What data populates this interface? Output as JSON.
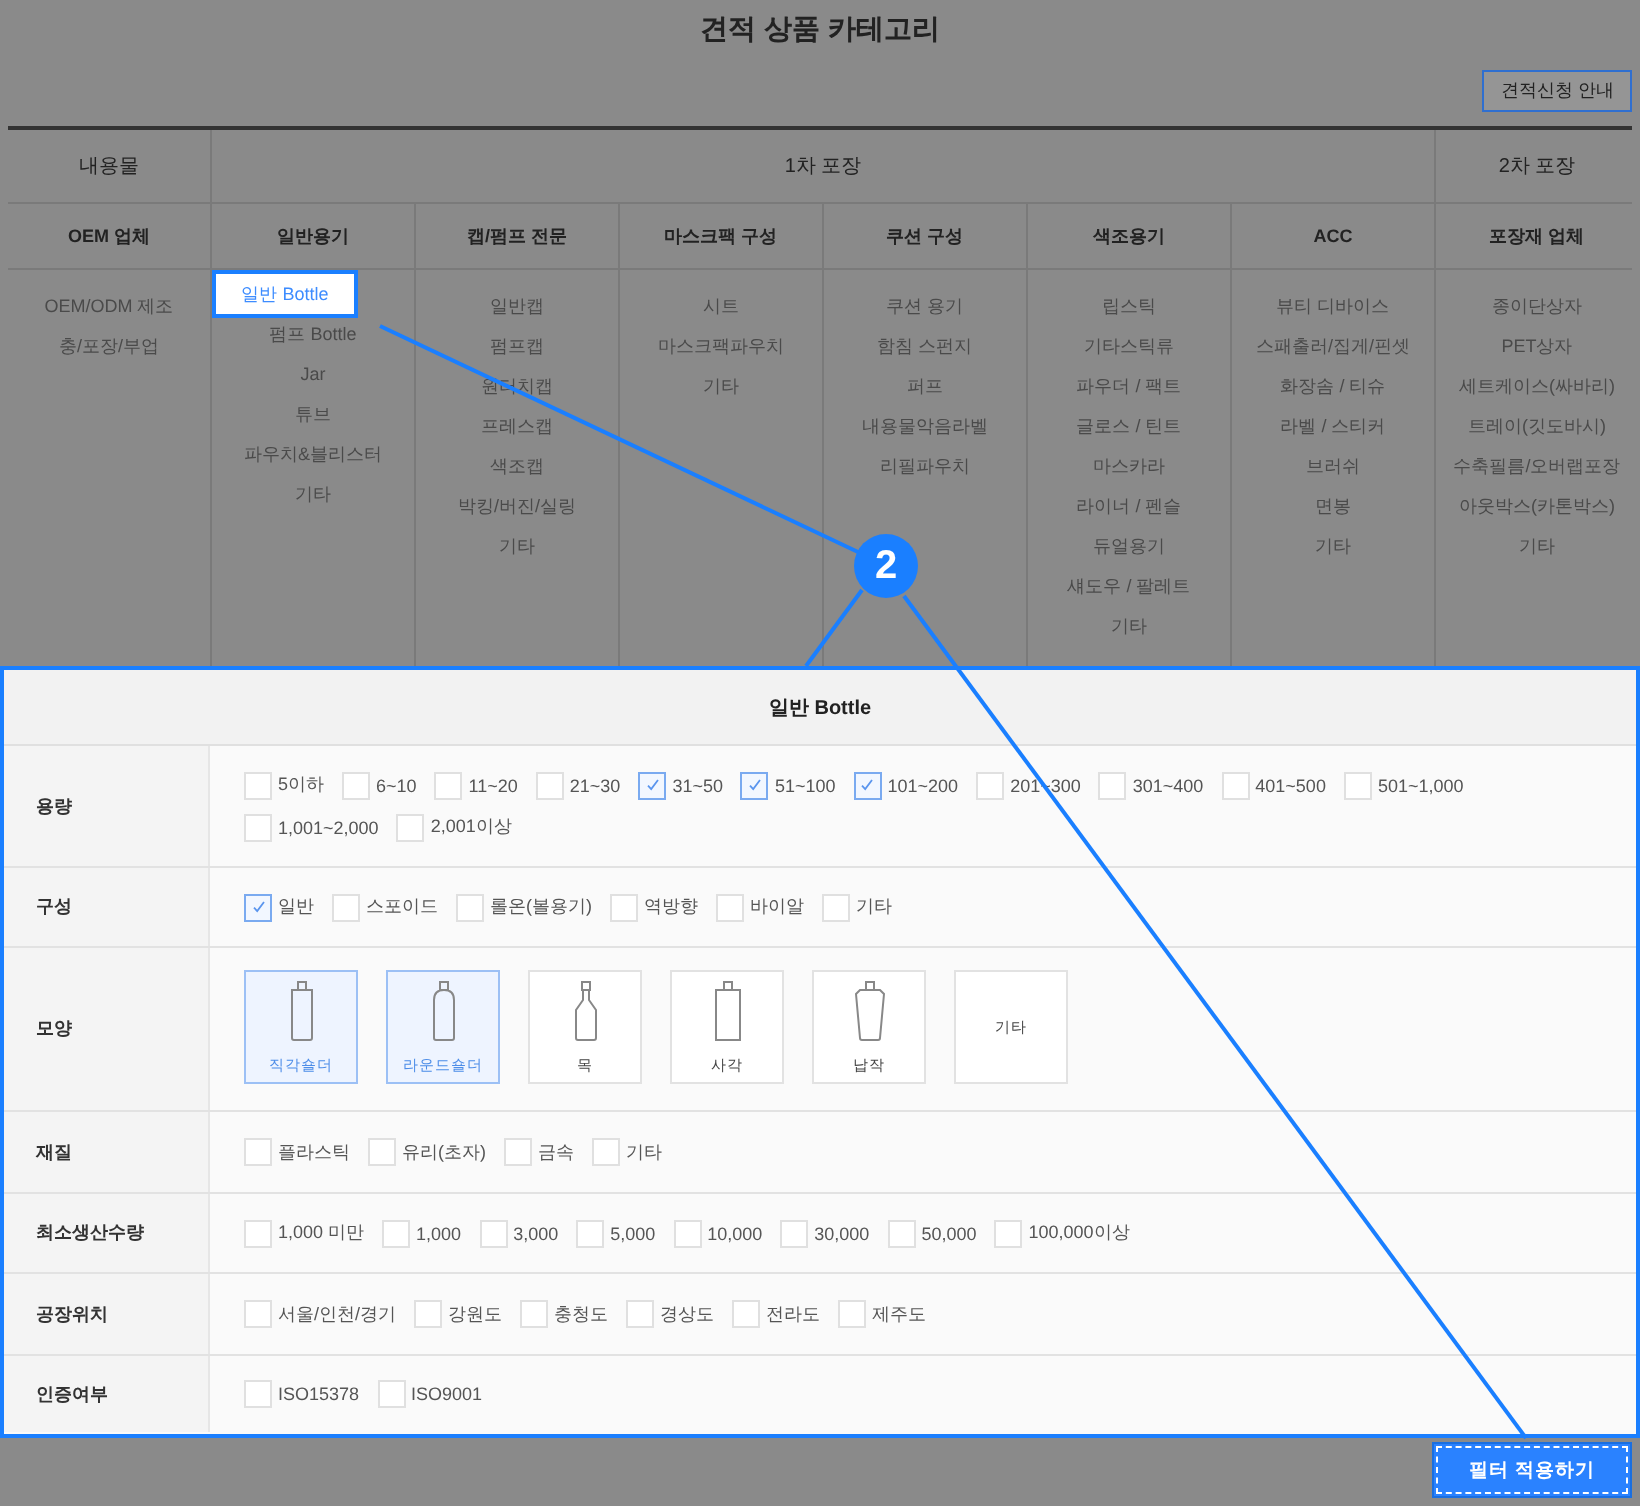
{
  "title": "견적 상품 카테고리",
  "guide_button": "견적신청 안내",
  "category_table": {
    "groups": [
      {
        "label": "내용물",
        "columns": [
          {
            "header": "OEM 업체",
            "items": [
              {
                "label": "OEM/ODM 제조",
                "selected": false
              },
              {
                "label": "충/포장/부업",
                "selected": false
              }
            ]
          }
        ]
      },
      {
        "label": "1차 포장",
        "columns": [
          {
            "header": "일반용기",
            "items": [
              {
                "label": "일반 Bottle",
                "selected": true
              },
              {
                "label": "펌프 Bottle",
                "selected": false
              },
              {
                "label": "Jar",
                "selected": false
              },
              {
                "label": "튜브",
                "selected": false
              },
              {
                "label": "파우치&블리스터",
                "selected": false
              },
              {
                "label": "기타",
                "selected": false
              }
            ]
          },
          {
            "header": "캡/펌프 전문",
            "items": [
              {
                "label": "일반캡",
                "selected": false
              },
              {
                "label": "펌프캡",
                "selected": false
              },
              {
                "label": "원터치캡",
                "selected": false
              },
              {
                "label": "프레스캡",
                "selected": false
              },
              {
                "label": "색조캡",
                "selected": false
              },
              {
                "label": "박킹/버진/실링",
                "selected": false
              },
              {
                "label": "기타",
                "selected": false
              }
            ]
          },
          {
            "header": "마스크팩 구성",
            "items": [
              {
                "label": "시트",
                "selected": false
              },
              {
                "label": "마스크팩파우치",
                "selected": false
              },
              {
                "label": "기타",
                "selected": false
              }
            ]
          },
          {
            "header": "쿠션 구성",
            "items": [
              {
                "label": "쿠션 용기",
                "selected": false
              },
              {
                "label": "함침 스펀지",
                "selected": false
              },
              {
                "label": "퍼프",
                "selected": false
              },
              {
                "label": "내용물악음라벨",
                "selected": false
              },
              {
                "label": "리필파우치",
                "selected": false
              }
            ]
          },
          {
            "header": "색조용기",
            "items": [
              {
                "label": "립스틱",
                "selected": false
              },
              {
                "label": "기타스틱류",
                "selected": false
              },
              {
                "label": "파우더 / 팩트",
                "selected": false
              },
              {
                "label": "글로스 / 틴트",
                "selected": false
              },
              {
                "label": "마스카라",
                "selected": false
              },
              {
                "label": "라이너 / 펜슬",
                "selected": false
              },
              {
                "label": "듀얼용기",
                "selected": false
              },
              {
                "label": "섀도우 / 팔레트",
                "selected": false
              },
              {
                "label": "기타",
                "selected": false
              }
            ]
          },
          {
            "header": "ACC",
            "items": [
              {
                "label": "뷰티 디바이스",
                "selected": false
              },
              {
                "label": "스패출러/집게/핀셋",
                "selected": false
              },
              {
                "label": "화장솜 / 티슈",
                "selected": false
              },
              {
                "label": "라벨 / 스티커",
                "selected": false
              },
              {
                "label": "브러쉬",
                "selected": false
              },
              {
                "label": "면봉",
                "selected": false
              },
              {
                "label": "기타",
                "selected": false
              }
            ]
          }
        ]
      },
      {
        "label": "2차 포장",
        "columns": [
          {
            "header": "포장재 업체",
            "items": [
              {
                "label": "종이단상자",
                "selected": false
              },
              {
                "label": "PET상자",
                "selected": false
              },
              {
                "label": "세트케이스(싸바리)",
                "selected": false
              },
              {
                "label": "트레이(깃도바시)",
                "selected": false
              },
              {
                "label": "수축필름/오버랩포장",
                "selected": false
              },
              {
                "label": "아웃박스(카톤박스)",
                "selected": false
              },
              {
                "label": "기타",
                "selected": false
              }
            ]
          }
        ]
      }
    ]
  },
  "filter_panel": {
    "title": "일반 Bottle",
    "rows": [
      {
        "label": "용량",
        "kind": "checkbox",
        "options": [
          {
            "label": "5이하",
            "checked": false
          },
          {
            "label": "6~10",
            "checked": false
          },
          {
            "label": "11~20",
            "checked": false
          },
          {
            "label": "21~30",
            "checked": false
          },
          {
            "label": "31~50",
            "checked": true
          },
          {
            "label": "51~100",
            "checked": true
          },
          {
            "label": "101~200",
            "checked": true
          },
          {
            "label": "201~300",
            "checked": false
          },
          {
            "label": "301~400",
            "checked": false
          },
          {
            "label": "401~500",
            "checked": false
          },
          {
            "label": "501~1,000",
            "checked": false
          },
          {
            "label": "1,001~2,000",
            "checked": false
          },
          {
            "label": "2,001이상",
            "checked": false
          }
        ]
      },
      {
        "label": "구성",
        "kind": "checkbox",
        "options": [
          {
            "label": "일반",
            "checked": true
          },
          {
            "label": "스포이드",
            "checked": false
          },
          {
            "label": "롤온(볼용기)",
            "checked": false
          },
          {
            "label": "역방향",
            "checked": false
          },
          {
            "label": "바이알",
            "checked": false
          },
          {
            "label": "기타",
            "checked": false
          }
        ]
      },
      {
        "label": "모양",
        "kind": "shape",
        "options": [
          {
            "label": "직각숄더",
            "kind": "straight",
            "selected": true
          },
          {
            "label": "라운드숄더",
            "kind": "round",
            "selected": true
          },
          {
            "label": "목",
            "kind": "neck",
            "selected": false
          },
          {
            "label": "사각",
            "kind": "square",
            "selected": false
          },
          {
            "label": "납작",
            "kind": "tapered",
            "selected": false
          },
          {
            "label": "기타",
            "kind": "none",
            "selected": false
          }
        ]
      },
      {
        "label": "재질",
        "kind": "checkbox",
        "options": [
          {
            "label": "플라스틱",
            "checked": false
          },
          {
            "label": "유리(초자)",
            "checked": false
          },
          {
            "label": "금속",
            "checked": false
          },
          {
            "label": "기타",
            "checked": false
          }
        ]
      },
      {
        "label": "최소생산수량",
        "kind": "checkbox",
        "options": [
          {
            "label": "1,000 미만",
            "checked": false
          },
          {
            "label": "1,000",
            "checked": false
          },
          {
            "label": "3,000",
            "checked": false
          },
          {
            "label": "5,000",
            "checked": false
          },
          {
            "label": "10,000",
            "checked": false
          },
          {
            "label": "30,000",
            "checked": false
          },
          {
            "label": "50,000",
            "checked": false
          },
          {
            "label": "100,000이상",
            "checked": false
          }
        ]
      },
      {
        "label": "공장위치",
        "kind": "checkbox",
        "options": [
          {
            "label": "서울/인천/경기",
            "checked": false
          },
          {
            "label": "강원도",
            "checked": false
          },
          {
            "label": "충청도",
            "checked": false
          },
          {
            "label": "경상도",
            "checked": false
          },
          {
            "label": "전라도",
            "checked": false
          },
          {
            "label": "제주도",
            "checked": false
          }
        ]
      },
      {
        "label": "인증여부",
        "kind": "checkbox",
        "options": [
          {
            "label": "ISO15378",
            "checked": false
          },
          {
            "label": "ISO9001",
            "checked": false
          }
        ]
      }
    ]
  },
  "apply_button": "필터 적용하기",
  "callout": {
    "number": "2"
  }
}
